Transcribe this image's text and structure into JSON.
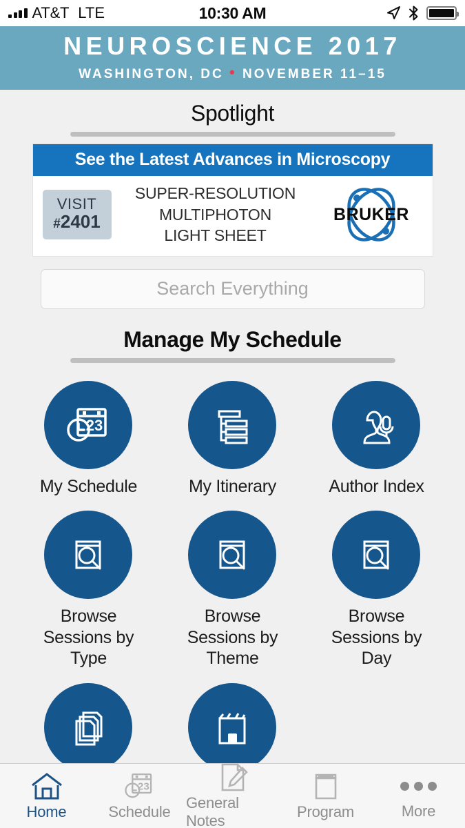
{
  "status_bar": {
    "carrier": "AT&T",
    "network": "LTE",
    "time": "10:30 AM",
    "icons": [
      "signal-bars-icon",
      "location-arrow-icon",
      "bluetooth-icon",
      "battery-full-icon"
    ]
  },
  "header": {
    "title": "NEUROSCIENCE 2017",
    "subtitle_location": "WASHINGTON, DC",
    "subtitle_separator": "•",
    "subtitle_dates": "NOVEMBER 11–15",
    "background_color": "#6aa8c0",
    "accent_dot_color": "#e23c4e"
  },
  "spotlight": {
    "heading": "Spotlight",
    "ad": {
      "banner_text": "See the Latest Advances in Microscopy",
      "banner_color": "#1574bd",
      "visit_label": "VISIT",
      "visit_hash": "#",
      "visit_booth": "2401",
      "features": [
        "SUPER-RESOLUTION",
        "MULTIPHOTON",
        "LIGHT SHEET"
      ],
      "brand": "BRUKER",
      "brand_color": "#1a6fb5"
    }
  },
  "search": {
    "placeholder": "Search Everything",
    "value": ""
  },
  "schedule_section": {
    "heading": "Manage My Schedule",
    "tiles": [
      {
        "label": "My Schedule",
        "icon": "calendar-clock-icon"
      },
      {
        "label": "My Itinerary",
        "icon": "itinerary-list-icon"
      },
      {
        "label": "Author Index",
        "icon": "speaker-microphone-icon"
      },
      {
        "label": "Browse Sessions by Type",
        "icon": "book-search-icon"
      },
      {
        "label": "Browse Sessions by Theme",
        "icon": "book-search-icon"
      },
      {
        "label": "Browse Sessions by Day",
        "icon": "book-search-icon"
      },
      {
        "label": "",
        "icon": "document-stack-icon"
      },
      {
        "label": "",
        "icon": "exhibit-booth-icon"
      }
    ],
    "tile_color": "#15568c",
    "calendar_day": "23"
  },
  "tab_bar": {
    "active": "Home",
    "active_color": "#1d5384",
    "inactive_color": "#8d8d8d",
    "items": [
      {
        "label": "Home",
        "icon": "home-icon"
      },
      {
        "label": "Schedule",
        "icon": "calendar-clock-icon"
      },
      {
        "label": "General Notes",
        "icon": "note-pencil-icon"
      },
      {
        "label": "Program",
        "icon": "book-icon"
      },
      {
        "label": "More",
        "icon": "ellipsis-icon"
      }
    ]
  }
}
